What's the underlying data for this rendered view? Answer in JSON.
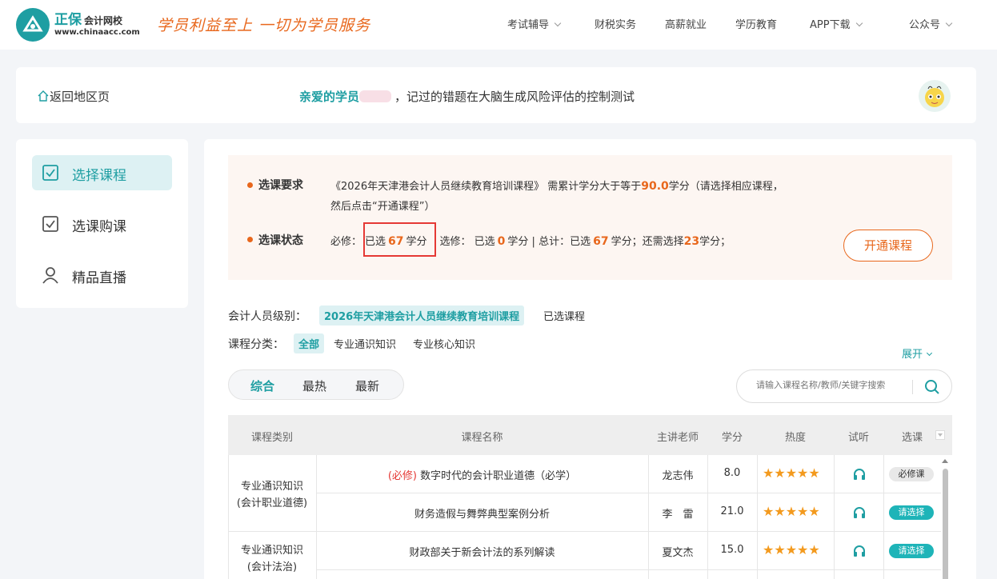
{
  "brand": {
    "name": "正保",
    "sub": "会计网校",
    "url": "www.chinaacc.com",
    "slogan": "学员利益至上  一切为学员服务"
  },
  "nav": [
    {
      "label": "考试辅导",
      "dropdown": true
    },
    {
      "label": "财税实务",
      "dropdown": false
    },
    {
      "label": "高薪就业",
      "dropdown": false
    },
    {
      "label": "学历教育",
      "dropdown": false
    },
    {
      "label": "APP下载",
      "dropdown": true
    },
    {
      "label": "公众号",
      "dropdown": true
    }
  ],
  "header": {
    "back_label": "返回地区页",
    "greeting_name": "亲爱的学员",
    "greeting_text": "，记过的错题在大脑生成风险评估的控制测试"
  },
  "sidebar": {
    "items": [
      {
        "label": "选择课程",
        "icon": "checkbox-icon",
        "active": true
      },
      {
        "label": "选课购课",
        "icon": "checkbox-icon",
        "active": false
      },
      {
        "label": "精品直播",
        "icon": "user-icon",
        "active": false
      }
    ]
  },
  "notice": {
    "req_title": "选课要求",
    "req_line1_a": "《2026年天津港会计人员继续教育培训课程》 需累计学分大于等于",
    "req_value": "90.0",
    "req_line1_b": "学分（请选择相应课程，",
    "req_line2": "然后点击“开通课程”）",
    "status_title": "选课状态",
    "s_required_label": "必修：",
    "s_selected_label": "已选",
    "s_required_value": "67",
    "s_unit": "学分",
    "s_elective_label": "选修：  已选",
    "s_elective_value": "0",
    "s_total_label": "学分 | 总计：已选",
    "s_total_value": "67",
    "s_remain_label": "学分；还需选择",
    "s_remain_value": "23",
    "s_end": "学分；",
    "open_button": "开通课程"
  },
  "filters": {
    "level_label": "会计人员级别：",
    "level_active": "2026年天津港会计人员继续教育培训课程",
    "level_other": "已选课程",
    "cat_label": "课程分类：",
    "cat_items": [
      "全部",
      "专业通识知识",
      "专业核心知识"
    ],
    "expand_label": "展开"
  },
  "sort": {
    "items": [
      "综合",
      "最热",
      "最新"
    ],
    "active": 0
  },
  "search": {
    "placeholder": "请输入课程名称/教师/关键字搜索"
  },
  "table": {
    "headers": [
      "课程类别",
      "课程名称",
      "主讲老师",
      "学分",
      "热度",
      "试听",
      "选课"
    ],
    "groups": [
      {
        "category_line1": "专业通识知识",
        "category_line2": "(会计职业道德)"
      },
      {
        "category_line1": "专业通识知识",
        "category_line2": "(会计法治)"
      }
    ],
    "rows": [
      {
        "tag": "(必修)",
        "name": "数字时代的会计职业道德（必学）",
        "teacher": "龙志伟",
        "credit": "8.0",
        "stars": "★★★★★",
        "action": "必修课",
        "action_type": "gray"
      },
      {
        "tag": "",
        "name": "财务造假与舞弊典型案例分析",
        "teacher": "李　雷",
        "credit": "21.0",
        "stars": "★★★★★",
        "action": "请选择",
        "action_type": "teal"
      },
      {
        "tag": "",
        "name": "财政部关于新会计法的系列解读",
        "teacher": "夏文杰",
        "credit": "15.0",
        "stars": "★★★★★",
        "action": "请选择",
        "action_type": "teal"
      }
    ]
  },
  "colors": {
    "accent": "#1e9ea2",
    "orange": "#e8671c",
    "highlight_border": "#e53935"
  }
}
